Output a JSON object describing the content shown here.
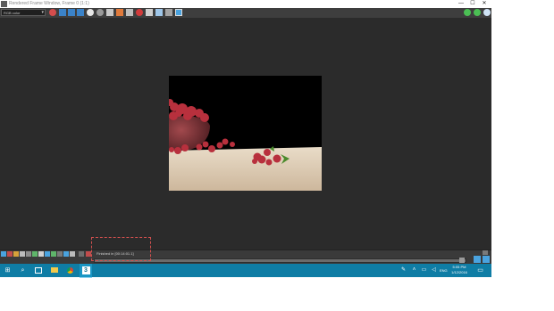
{
  "window": {
    "title": "Rendered Frame Window, Frame 0 (1:1)",
    "controls": [
      "—",
      "☐",
      "✕"
    ]
  },
  "toolbar": {
    "channel_select": "RGB color",
    "channel_chevron": "▾",
    "buttons": [
      "area-to-render-icon",
      "view-icon",
      "region-icon",
      "crop-icon",
      "blowup-icon",
      "color-swatch-icon",
      "save-image-icon",
      "copy-image-icon",
      "clone-window-icon",
      "print-icon",
      "clear-icon",
      "alpha-channel-icon",
      "monochrome-icon",
      "render-icon"
    ],
    "right_buttons": [
      "lock-icon",
      "settings-icon",
      "help-icon"
    ]
  },
  "render_image": {
    "description_tag": "raspberries-render"
  },
  "bottom_panel": {
    "status": "Finished in [00:14:01.1]",
    "left_icons": [
      "render-setup-icon",
      "material-icon",
      "environment-icon",
      "effects-icon",
      "history-icon",
      "settings-icon",
      "preview-icon",
      "frame-icon",
      "copy-icon",
      "compare-icon",
      "stats-icon",
      "log-icon",
      "layers-icon"
    ],
    "progress_value": 1.0
  },
  "taskbar": {
    "start_glyph": "⊞",
    "search_glyph": "⌕",
    "apps": [
      "task-view-icon",
      "file-explorer-icon",
      "chrome-icon",
      "3dsmax-icon"
    ],
    "app_3ds_label": "3",
    "lang": "ENG",
    "time": "5:05 PM",
    "date": "1/12/2016",
    "notification_glyph": "▭"
  },
  "colors": {
    "accent": "#0f7da5",
    "window_bg": "#2b2b2b",
    "highlight_border": "#d0504e"
  }
}
